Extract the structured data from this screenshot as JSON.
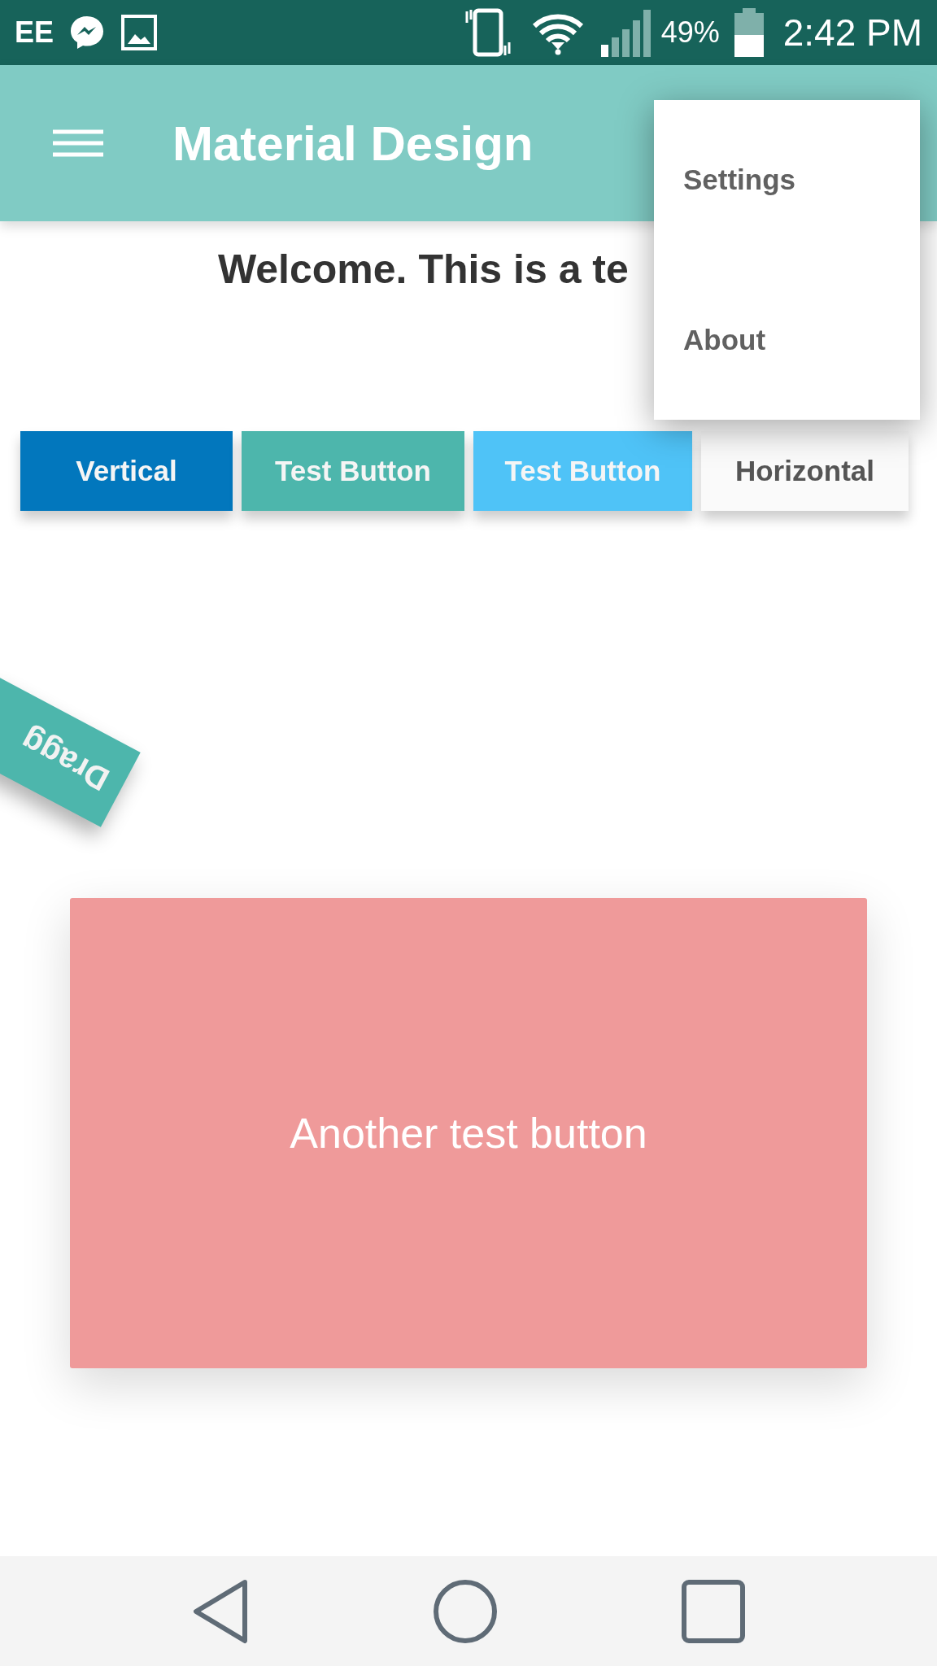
{
  "status_bar": {
    "carrier": "EE",
    "battery": "49%",
    "time": "2:42 PM"
  },
  "app_bar": {
    "title": "Material Design"
  },
  "overflow_menu": {
    "items": [
      {
        "label": "Settings"
      },
      {
        "label": "About"
      }
    ]
  },
  "welcome": "Welcome. This is a te",
  "buttons": [
    {
      "label": "Vertical",
      "color": "#0277bd"
    },
    {
      "label": "Test Button",
      "color": "#4db6ac"
    },
    {
      "label": "Test Button",
      "color": "#4fc3f7"
    },
    {
      "label": "Horizontal",
      "color": "#fafafa"
    }
  ],
  "drag_button": {
    "label": "Dragg"
  },
  "big_button": {
    "label": "Another test button"
  }
}
